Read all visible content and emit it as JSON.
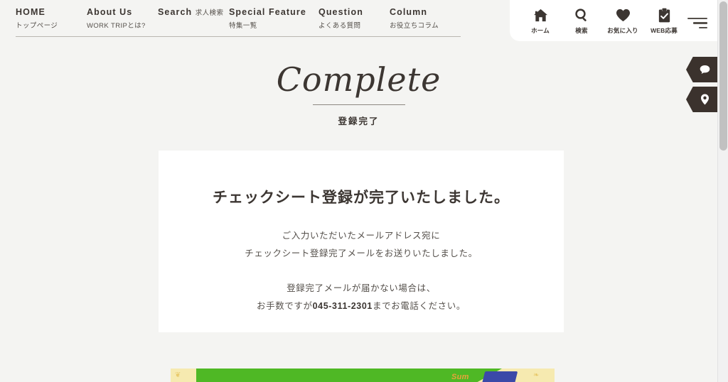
{
  "nav": {
    "items": [
      {
        "en": "HOME",
        "ja": "トップページ"
      },
      {
        "en": "About Us",
        "ja": "WORK TRIPとは?"
      },
      {
        "en": "Search",
        "ja": "求人検索"
      },
      {
        "en": "Special Feature",
        "ja": "特集一覧"
      },
      {
        "en": "Question",
        "ja": "よくある質問"
      },
      {
        "en": "Column",
        "ja": "お役立ちコラム"
      }
    ]
  },
  "header_panel": {
    "items": [
      {
        "icon": "home-icon",
        "label": "ホーム"
      },
      {
        "icon": "search-icon",
        "label": "検索"
      },
      {
        "icon": "heart-icon",
        "label": "お気に入り"
      },
      {
        "icon": "clipboard-check-icon",
        "label": "WEB応募"
      }
    ],
    "menu_icon": "hamburger-menu-icon"
  },
  "side_tabs": [
    {
      "icon": "chat-bubble-icon"
    },
    {
      "icon": "map-pin-icon"
    }
  ],
  "page_title": {
    "script": "Complete",
    "japanese": "登録完了"
  },
  "card": {
    "heading": "チェックシート登録が完了いたしました。",
    "paragraph1_line1": "ご入力いただいたメールアドレス宛に",
    "paragraph1_line2": "チェックシート登録完了メールをお送りいたしました。",
    "paragraph2_line1": "登録完了メールが届かない場合は、",
    "paragraph2_before_tel": "お手数ですが",
    "telephone": "045-311-2301",
    "paragraph2_after_tel": "までお電話ください。"
  },
  "banner": {
    "text": "Sum",
    "leaf_left": "❦",
    "leaf_right": "❧"
  },
  "colors": {
    "page_background": "#f4f4f2",
    "card_background": "#ffffff",
    "text_primary": "#3c3632",
    "text_secondary": "#55504b",
    "side_tab": "#3b322d",
    "banner_cream": "#f6eab0",
    "banner_green": "#4fb825",
    "banner_blue": "#3b49a8"
  }
}
